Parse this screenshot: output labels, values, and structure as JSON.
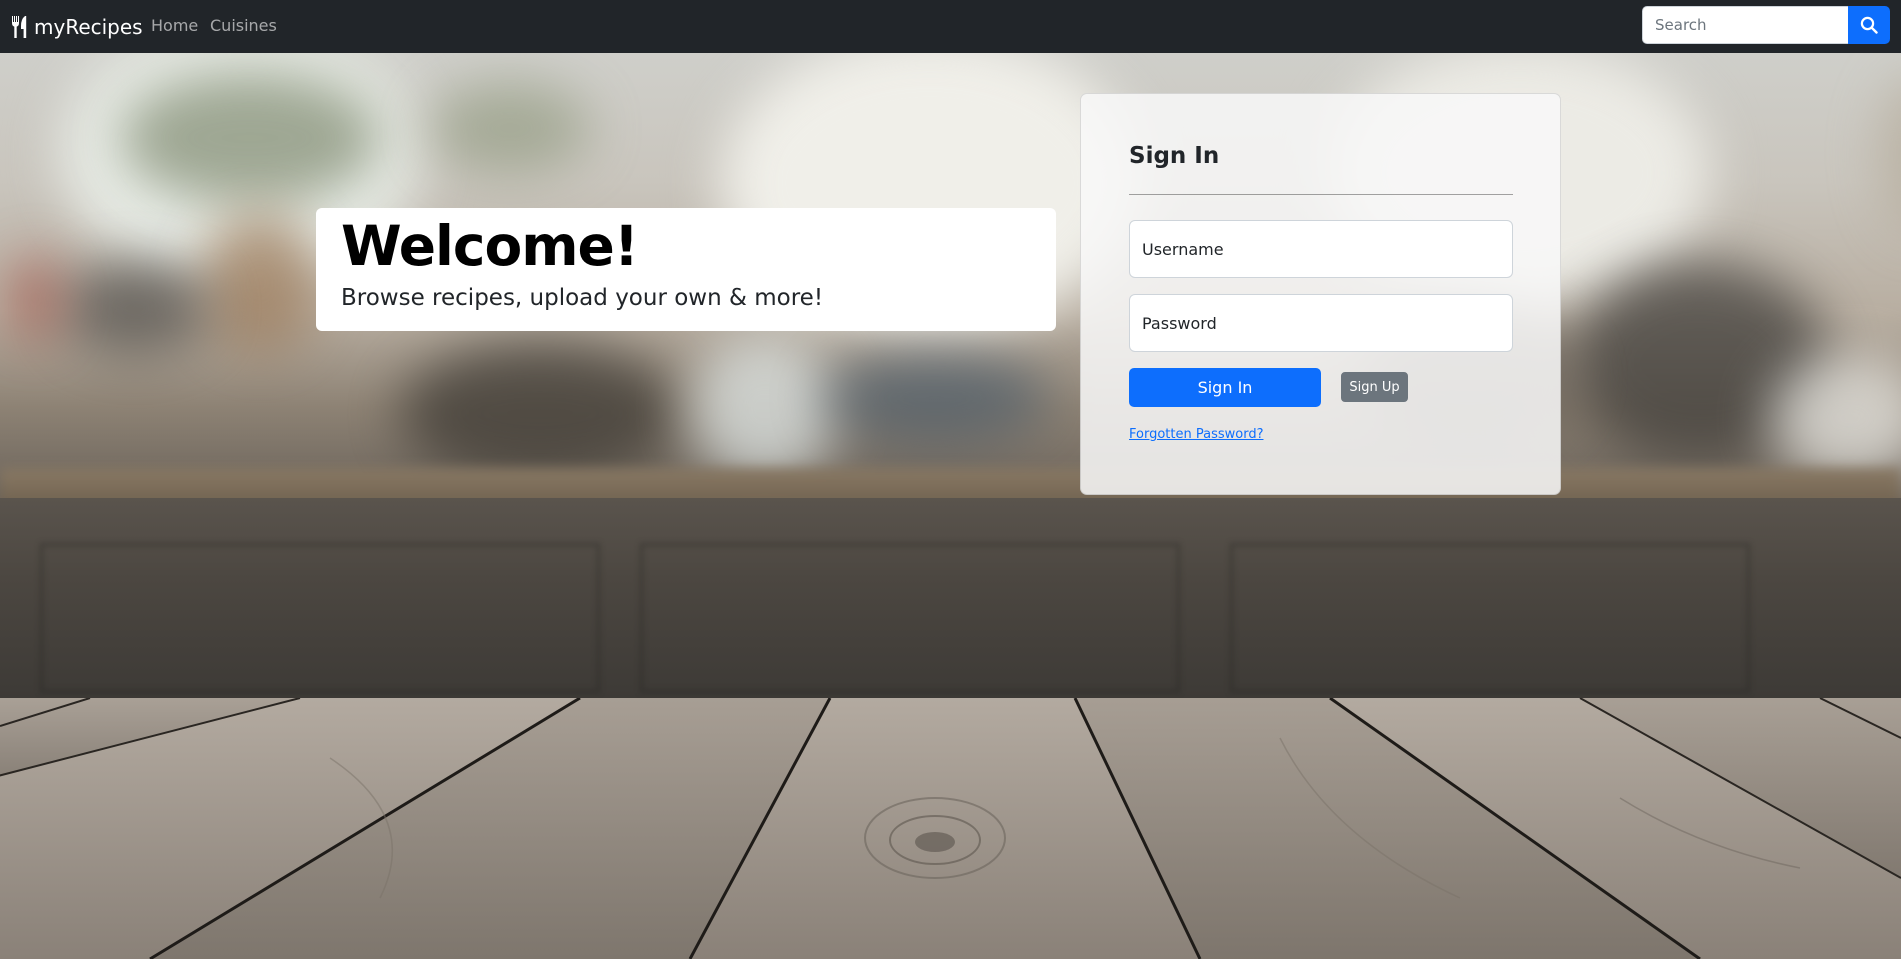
{
  "navbar": {
    "brand": "myRecipes",
    "links": [
      "Home",
      "Cuisines"
    ],
    "search_placeholder": "Search",
    "brand_icon": "utensils-icon",
    "search_icon": "search-icon"
  },
  "welcome": {
    "title": "Welcome!",
    "subtitle": "Browse recipes, upload your own & more!"
  },
  "signin": {
    "title": "Sign In",
    "username_placeholder": "Username",
    "password_placeholder": "Password",
    "signin_label": "Sign In",
    "signup_label": "Sign Up",
    "forgot_label": "Forgotten Password?"
  },
  "colors": {
    "navbar": "#212529",
    "primary": "#0d6efd",
    "secondary": "#6c757d"
  }
}
